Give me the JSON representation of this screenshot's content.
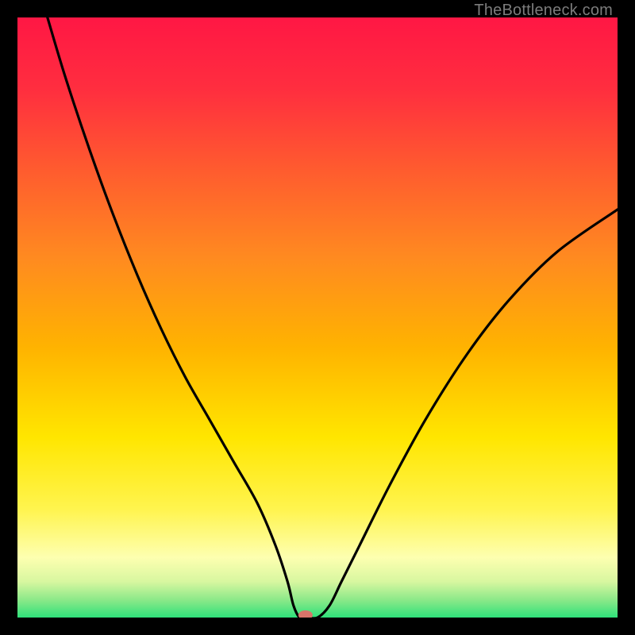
{
  "watermark": "TheBottleneck.com",
  "chart_data": {
    "type": "line",
    "title": "",
    "xlabel": "",
    "ylabel": "",
    "xlim": [
      0,
      100
    ],
    "ylim": [
      0,
      100
    ],
    "grid": false,
    "legend": false,
    "annotations": [],
    "background_gradient_stops": [
      {
        "offset": 0.0,
        "color": "#ff1744"
      },
      {
        "offset": 0.12,
        "color": "#ff2e3f"
      },
      {
        "offset": 0.25,
        "color": "#ff5a2f"
      },
      {
        "offset": 0.4,
        "color": "#ff8a20"
      },
      {
        "offset": 0.55,
        "color": "#ffb300"
      },
      {
        "offset": 0.7,
        "color": "#ffe600"
      },
      {
        "offset": 0.82,
        "color": "#fff44f"
      },
      {
        "offset": 0.9,
        "color": "#fdffb0"
      },
      {
        "offset": 0.94,
        "color": "#d8f7a0"
      },
      {
        "offset": 0.97,
        "color": "#8de989"
      },
      {
        "offset": 1.0,
        "color": "#2fe17a"
      }
    ],
    "series": [
      {
        "name": "bottleneck-curve",
        "x": [
          5,
          8,
          12,
          16,
          20,
          24,
          28,
          32,
          36,
          40,
          43,
          45,
          46,
          47,
          48,
          50,
          52,
          54,
          57,
          62,
          68,
          75,
          82,
          90,
          100
        ],
        "y": [
          100,
          90,
          78,
          67,
          57,
          48,
          40,
          33,
          26,
          19,
          12,
          6,
          2,
          0,
          0,
          0,
          2,
          6,
          12,
          22,
          33,
          44,
          53,
          61,
          68
        ]
      }
    ],
    "marker": {
      "x": 48,
      "y": 0,
      "color": "#d9746a",
      "rx": 9,
      "ry": 6
    }
  }
}
